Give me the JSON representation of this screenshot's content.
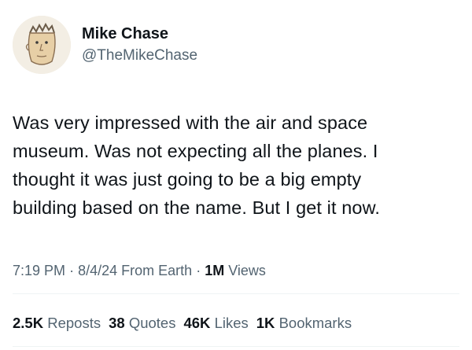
{
  "author": {
    "name": "Mike Chase",
    "handle": "@TheMikeChase"
  },
  "tweet": {
    "lines": [
      "Was very impressed with the air and space",
      "museum. Was not expecting all the planes. I",
      "thought it was just going to be a big empty",
      "building based on the name. But I get it now."
    ]
  },
  "meta": {
    "time": "7:19 PM",
    "sep1": "·",
    "date": "8/4/24",
    "source": "From Earth",
    "sep2": "·",
    "views_count": "1M",
    "views_label": "Views"
  },
  "stats": {
    "reposts_count": "2.5K",
    "reposts_label": "Reposts",
    "quotes_count": "38",
    "quotes_label": "Quotes",
    "likes_count": "46K",
    "likes_label": "Likes",
    "bookmarks_count": "1K",
    "bookmarks_label": "Bookmarks"
  }
}
